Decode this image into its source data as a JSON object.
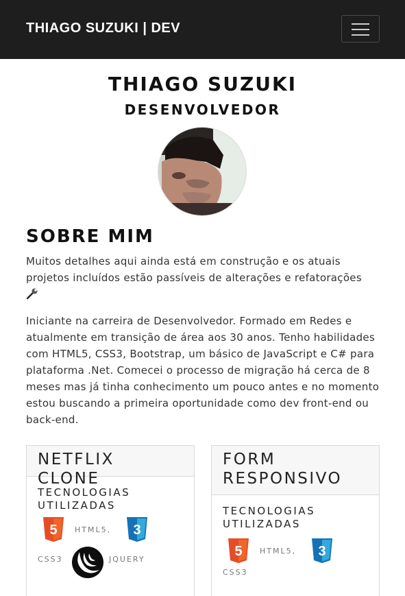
{
  "navbar": {
    "brand": "THIAGO SUZUKI | DEV",
    "toggle_icon": "menu-icon"
  },
  "hero": {
    "name": "THIAGO SUZUKI",
    "role": "DESENVOLVEDOR"
  },
  "about": {
    "title": "SOBRE MIM",
    "paragraph1": "Muitos detalhes aqui ainda está em construção e os atuais projetos incluídos estão passíveis de alterações e refatorações",
    "paragraph1_icon": "wrench-icon",
    "paragraph2": "Iniciante na carreira de Desenvolvedor. Formado em Redes e atualmente em transição de área aos 30 anos. Tenho habilidades com HTML5, CSS3, Bootstrap, um básico de JavaScript e C# para plataforma .Net. Comecei o processo de migração há cerca de 8 meses mas já tinha conhecimento um pouco antes e no momento estou buscando a primeira oportunidade como dev front-end ou back-end."
  },
  "projects": [
    {
      "title": "NETFLIX CLONE",
      "tech_title": "TECNOLOGIAS UTILIZADAS",
      "techs": [
        "HTML5,",
        "CSS3",
        "JQUERY"
      ],
      "icons": [
        "html5-icon",
        "css3-icon",
        "jquery-icon"
      ]
    },
    {
      "title": "FORM RESPONSIVO",
      "tech_title": "TECNOLOGIAS UTILIZADAS",
      "techs": [
        "HTML5,",
        "CSS3"
      ],
      "icons": [
        "html5-icon",
        "css3-icon"
      ]
    }
  ],
  "colors": {
    "navbar_bg": "#1e1e1e",
    "html5": "#e44d26",
    "css3": "#1572b6",
    "accent": "#1c8ad6"
  }
}
